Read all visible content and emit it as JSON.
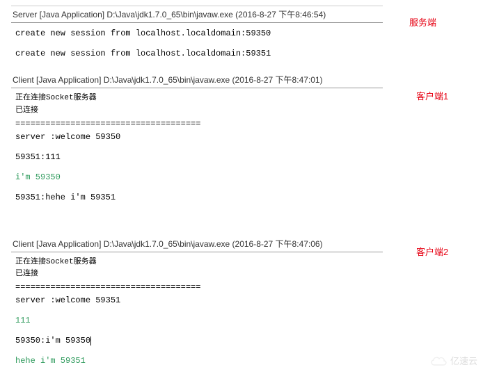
{
  "annotations": {
    "server": "服务端",
    "client1": "客户端1",
    "client2": "客户端2"
  },
  "panels": {
    "server": {
      "header": "Server [Java Application] D:\\Java\\jdk1.7.0_65\\bin\\javaw.exe (2016-8-27 下午8:46:54)",
      "lines": [
        "create new session from localhost.localdomain:59350",
        "",
        "create new session from localhost.localdomain:59351"
      ]
    },
    "client1": {
      "header": "Client [Java Application] D:\\Java\\jdk1.7.0_65\\bin\\javaw.exe (2016-8-27 下午8:47:01)",
      "status1": "正在连接Socket服务器",
      "status2": "已连接",
      "divider": "=====================================",
      "welcome": "server :welcome 59350",
      "msg1": "59351:111",
      "mymsg": "i'm 59350",
      "msg2": "59351:hehe i'm 59351"
    },
    "client2": {
      "header": "Client [Java Application] D:\\Java\\jdk1.7.0_65\\bin\\javaw.exe (2016-8-27 下午8:47:06)",
      "status1": "正在连接Socket服务器",
      "status2": "已连接",
      "divider": "=====================================",
      "welcome": "server :welcome 59351",
      "mymsg1": "111",
      "msg1": "59350:i'm 59350",
      "mymsg2": "hehe i'm 59351"
    }
  },
  "watermark": "亿速云"
}
